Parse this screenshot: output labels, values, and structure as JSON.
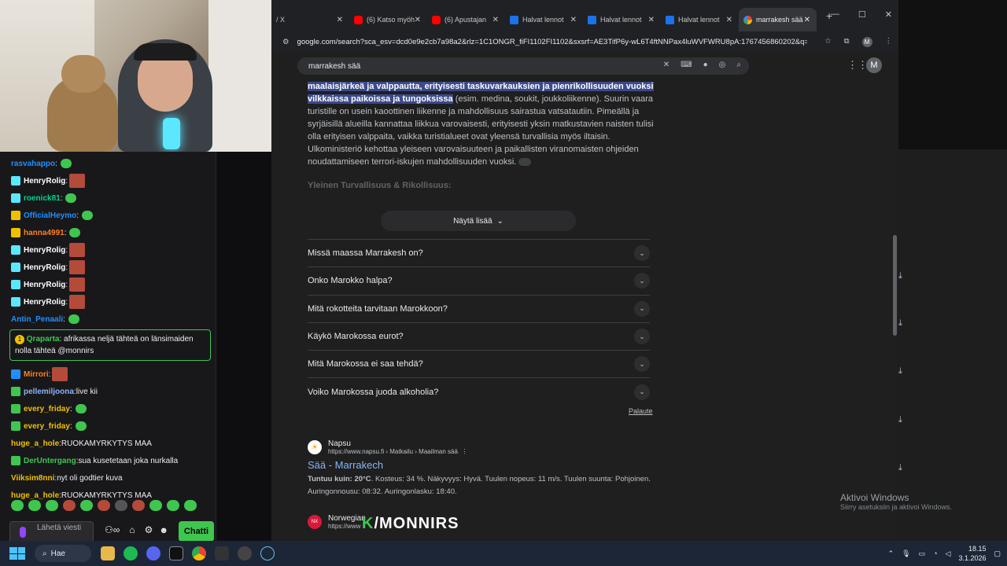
{
  "tabs": [
    {
      "title": "/ X",
      "favicon": "x-favicon"
    },
    {
      "title": "(6) Katso myöh",
      "favicon": "youtube-favicon"
    },
    {
      "title": "(6) Apustajan",
      "favicon": "youtube-favicon"
    },
    {
      "title": "Halvat lennot",
      "favicon": "flights-favicon"
    },
    {
      "title": "Halvat lennot",
      "favicon": "flights-favicon"
    },
    {
      "title": "Halvat lennot",
      "favicon": "flights-favicon"
    },
    {
      "title": "marrakesh sää",
      "favicon": "google-favicon",
      "active": true
    }
  ],
  "address": {
    "url": "google.com/search?sca_esv=dcd0e9e2cb7a98a2&rlz=1C1ONGR_fiFI1102FI1102&sxsrf=AE3TifP6y-wL6T4ftNNPax4luWVFWRU8pA:1767456860202&q=Ma...",
    "profile_initial": "M"
  },
  "search": {
    "query": "marrakesh sää",
    "profile_initial": "M"
  },
  "overview": {
    "highlight1": "maalaisjärkeä ja valppautta, erityisesti taskuvarkauksien ja pienrikollisuuden vuoksi",
    "highlight2": "vilkkaissa paikoissa ja tungoksissa",
    "body": "(esim. medina, soukit, joukkoliikenne). Suurin vaara turistille on usein kaoottinen liikenne ja mahdollisuus sairastua vatsatautiin. Pimeällä ja syrjäisillä alueilla kannattaa liikkua varovaisesti, erityisesti yksin matkustavien naisten tulisi olla erityisen valppaita, vaikka turistialueet ovat yleensä turvallisia myös iltaisin. Ulkoministeriö kehottaa yleiseen varovaisuuteen ja paikallisten viranomaisten ohjeiden noudattamiseen terrori-iskujen mahdollisuuden vuoksi.",
    "subheading": "Yleinen Turvallisuus & Rikollisuus:",
    "show_more": "Näytä lisää"
  },
  "faq": [
    "Missä maassa Marrakesh on?",
    "Onko Marokko halpa?",
    "Mitä rokotteita tarvitaan Marokkoon?",
    "Käykö Marokossa eurot?",
    "Mitä Marokossa ei saa tehdä?",
    "Voiko Marokossa juoda alkoholia?"
  ],
  "feedback_label": "Palaute",
  "result1": {
    "site": "Napsu",
    "url": "https://www.napsu.fi › Matkailu › Maailman sää",
    "title": "Sää - Marrakech",
    "snippet_bold": "Tuntuu kuin: 20°C",
    "snippet1": ". Kosteus: 34 %. Näkyvyys: Hyvä. Tuulen nopeus: 11 m/s. Tuulen suunta: Pohjoinen.",
    "snippet2": "Auringonnousu: 08:32. Auringonlasku: 18:40."
  },
  "result2": {
    "site": "Norwegian",
    "url": "https://www",
    "logo": "NX"
  },
  "watermark": {
    "k": "K",
    "text": "/MONNIRS"
  },
  "activate_windows": {
    "title": "Aktivoi Windows",
    "sub": "Siirry asetuksiin ja aktivoi Windows."
  },
  "chat": {
    "lines": [
      {
        "user": "rasvahappo",
        "color": "#1e90ff",
        "msg": "",
        "badge": ""
      },
      {
        "user": "HenryRolig",
        "color": "#ffffff",
        "msg": "",
        "badge": "#5be8ff"
      },
      {
        "user": "roenick81",
        "color": "#00d48e",
        "msg": "",
        "badge": "#5be8ff"
      },
      {
        "user": "OfficialHeymo",
        "color": "#1e90ff",
        "msg": "",
        "badge": "#f0c000"
      },
      {
        "user": "hanna4991",
        "color": "#ff7f24",
        "msg": "",
        "badge": "#f0c000"
      },
      {
        "user": "HenryRolig",
        "color": "#ffffff",
        "msg": "",
        "badge": "#5be8ff"
      },
      {
        "user": "HenryRolig",
        "color": "#ffffff",
        "msg": "",
        "badge": "#5be8ff"
      },
      {
        "user": "HenryRolig",
        "color": "#ffffff",
        "msg": "",
        "badge": "#5be8ff"
      },
      {
        "user": "HenryRolig",
        "color": "#ffffff",
        "msg": "",
        "badge": "#5be8ff"
      },
      {
        "user": "Antin_Penaali",
        "color": "#1e90ff",
        "msg": "",
        "badge": ""
      }
    ],
    "highlight": {
      "user": "Qraparta",
      "msg": "afrikassa neljä tähteä on länsimaiden nolla tähteä @monnirs"
    },
    "lines2": [
      {
        "user": "Mirrori",
        "color": "#ff7f24",
        "msg": "",
        "badge": "#1e90ff"
      },
      {
        "user": "pellemiljoona",
        "color": "#8ab4f8",
        "msg": "live kii",
        "badge": "#3fc64f"
      },
      {
        "user": "every_friday",
        "color": "#f0c000",
        "msg": "",
        "badge": "#3fc64f"
      },
      {
        "user": "every_friday",
        "color": "#f0c000",
        "msg": "",
        "badge": "#3fc64f"
      },
      {
        "user": "huge_a_hole",
        "color": "#f0c000",
        "msg": "RUOKAMYRKYTYS MAA",
        "badge": ""
      },
      {
        "user": "DerUntergang",
        "color": "#3fc64f",
        "msg": "sua kusetetaan joka nurkalla",
        "badge": "#3fc64f"
      },
      {
        "user": "Viiksim8nni",
        "color": "#f0c000",
        "msg": "nyt oli godtier kuva",
        "badge": ""
      },
      {
        "user": "huge_a_hole",
        "color": "#f0c000",
        "msg": "RUOKAMYRKYTYS MAA",
        "badge": ""
      }
    ],
    "input_placeholder": "Lähetä viesti",
    "send_label": "Chatti"
  },
  "taskbar": {
    "search_label": "Hae",
    "time": "18.15",
    "date": "3.1.2026"
  },
  "colors": {
    "accent_green": "#3fc64f",
    "link_blue": "#8ab4f8",
    "highlight_bg": "#3b4a8a"
  }
}
